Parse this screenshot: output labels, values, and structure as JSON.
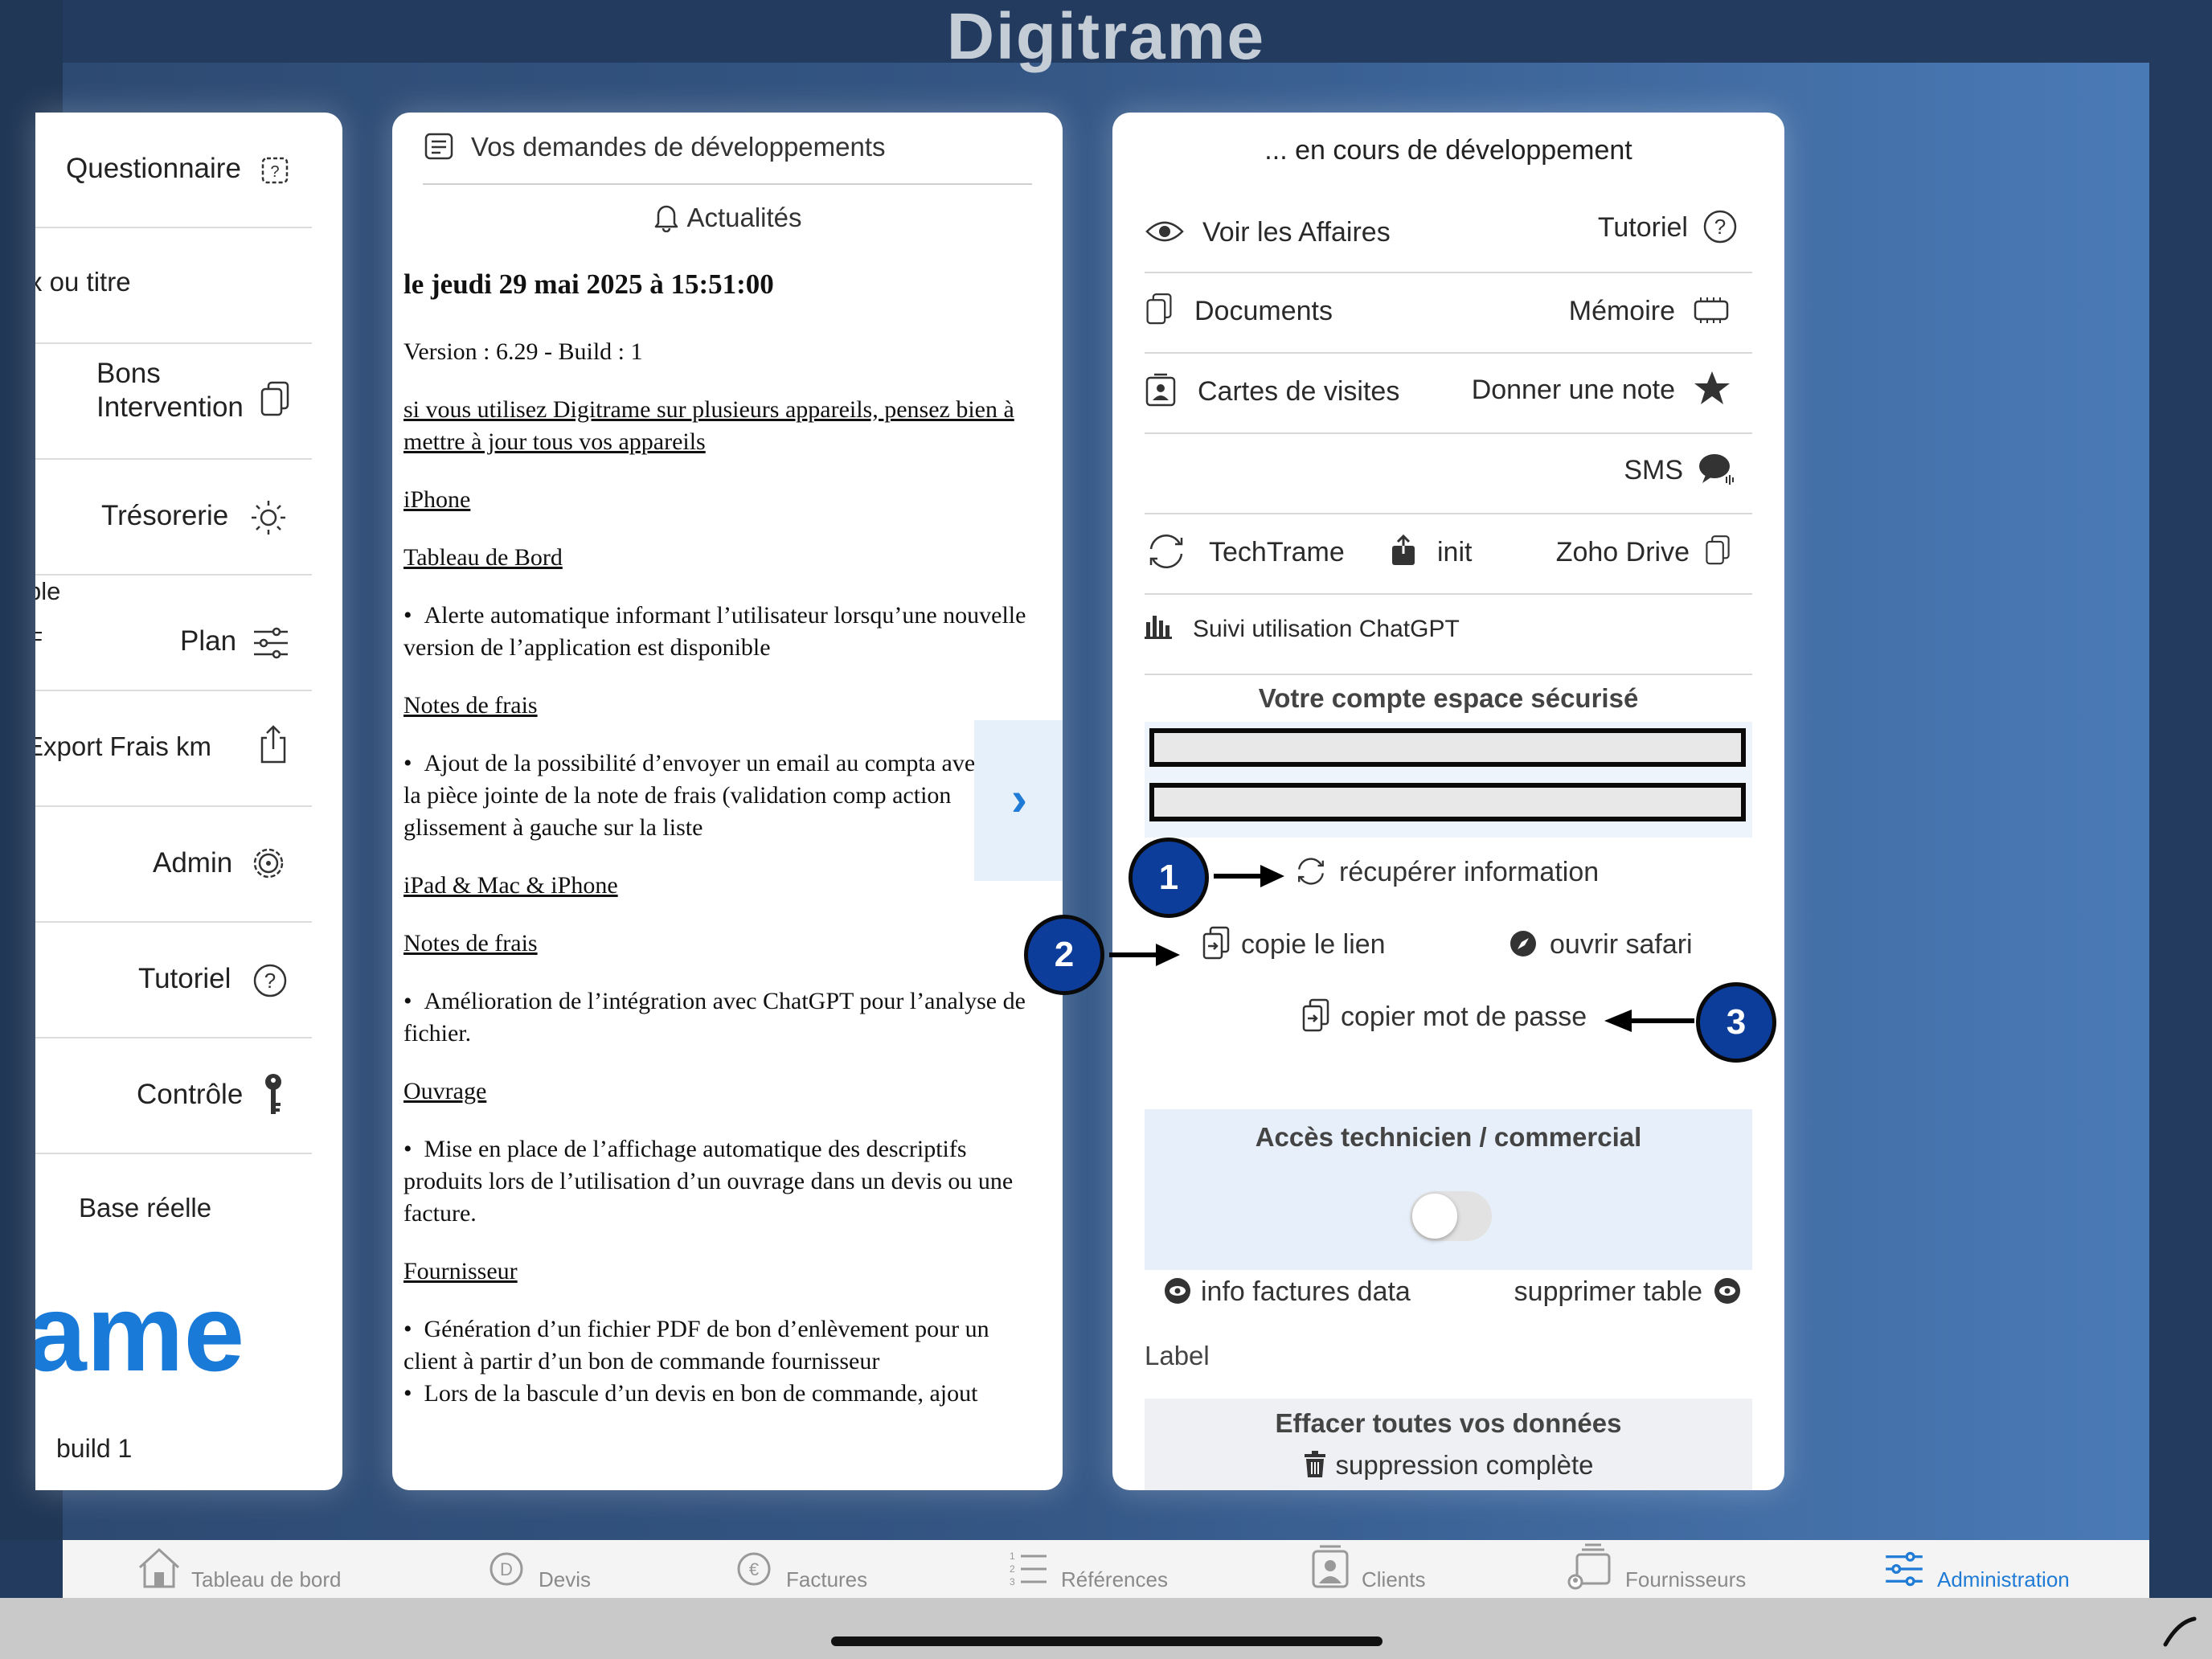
{
  "app": {
    "brand": "Digitrame"
  },
  "left_panel": {
    "items": [
      {
        "label": "Questionnaire",
        "icon": "question-box-icon"
      },
      {
        "label": "x ou titre",
        "icon": ""
      },
      {
        "label": "Bons Intervention",
        "icon": "documents-icon"
      },
      {
        "label": "Trésorerie",
        "icon": "sun-icon"
      },
      {
        "label": "Plan",
        "icon": "sliders-icon"
      },
      {
        "label": "Export Frais km",
        "icon": "share-icon"
      },
      {
        "label": "Admin",
        "icon": "gear-icon"
      },
      {
        "label": "Tutoriel",
        "icon": "help-circle-icon"
      },
      {
        "label": "Contrôle",
        "icon": "key-icon"
      },
      {
        "label": "Base réelle",
        "icon": ""
      }
    ],
    "fragment_ble": "ble",
    "fragment_f": "F",
    "logo_fragment": "ame",
    "build": "build 1"
  },
  "middle_panel": {
    "header": "Vos demandes de développements",
    "news_label": "Actualités",
    "date": "le jeudi 29 mai 2025 à 15:51:00",
    "version": "Version : 6.29 - Build : 1",
    "notice": "si vous utilisez Digitrame sur plusieurs appareils, pensez bien à mettre à jour tous vos appareils",
    "h_iphone": "iPhone",
    "h_tableau": "Tableau de Bord",
    "b_alerte": "Alerte automatique informant l’utilisateur lorsqu’une nouvelle version de l’application est disponible",
    "h_notes1": "Notes de frais",
    "b_email": "Ajout de la possibilité d’envoyer un email au compta avec la pièce jointe de la note de frais (validation comp action glissement à gauche sur la liste",
    "h_ipad": "iPad & Mac & iPhone",
    "h_notes2": "Notes de frais",
    "b_chatgpt": "Amélioration de l’intégration avec ChatGPT pour l’analyse de fichier.",
    "h_ouvrage": "Ouvrage",
    "b_ouvrage": "Mise en place de l’affichage automatique des descriptifs produits lors de l’utilisation d’un ouvrage dans un devis ou une facture.",
    "h_fournisseur": "Fournisseur",
    "b_pdf": "Génération d’un fichier PDF de bon d’enlèvement pour un client à partir d’un bon de commande fournisseur",
    "b_bascule": "Lors de la bascule d’un devis en bon de commande, ajout",
    "expand_glyph": "›"
  },
  "right_panel": {
    "title": "... en cours de développement",
    "voir_affaires": "Voir les Affaires",
    "tutoriel": "Tutoriel",
    "documents": "Documents",
    "memoire": "Mémoire",
    "cartes": "Cartes de visites",
    "donner_note": "Donner une note",
    "sms": "SMS",
    "techtrame": "TechTrame",
    "init": "init",
    "zoho": "Zoho Drive",
    "suivi": "Suivi utilisation ChatGPT",
    "secure_title": "Votre compte espace sécurisé",
    "field1_value": "",
    "field2_value": "",
    "recuperer": "récupérer information",
    "copie_lien": "copie le lien",
    "ouvrir_safari": "ouvrir safari",
    "copier_mdp": "copier mot de passe",
    "acces_title": "Accès technicien / commercial",
    "toggle_on": false,
    "info_factures": "info factures data",
    "supprimer_table": "supprimer table",
    "label": "Label",
    "effacer_title": "Effacer toutes vos données",
    "suppression": "suppression complète"
  },
  "callouts": [
    "1",
    "2",
    "3"
  ],
  "tabbar": {
    "tabs": [
      {
        "label": "Tableau de bord",
        "icon": "house-icon",
        "active": false
      },
      {
        "label": "Devis",
        "icon": "devis-icon",
        "active": false
      },
      {
        "label": "Factures",
        "icon": "euro-icon",
        "active": false
      },
      {
        "label": "Références",
        "icon": "numbered-list-icon",
        "active": false
      },
      {
        "label": "Clients",
        "icon": "clients-icon",
        "active": false
      },
      {
        "label": "Fournisseurs",
        "icon": "fournisseurs-icon",
        "active": false
      },
      {
        "label": "Administration",
        "icon": "sliders-icon",
        "active": true
      }
    ]
  },
  "colors": {
    "accent": "#1f7bd6",
    "callout": "#0d3d9a",
    "background": "#2d4a72"
  }
}
